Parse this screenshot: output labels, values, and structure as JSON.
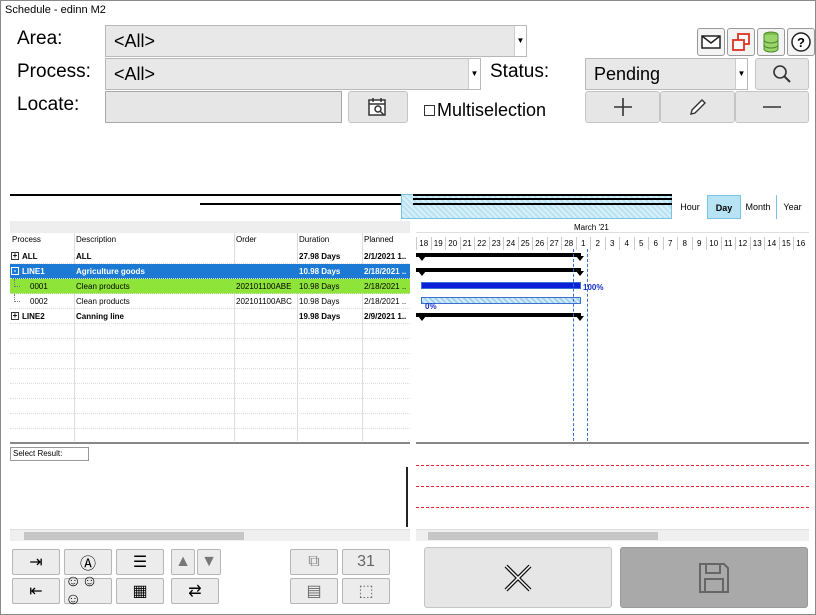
{
  "window": {
    "title": "Schedule - edinn M2"
  },
  "filters": {
    "area_label": "Area:",
    "area_value": "<All>",
    "process_label": "Process:",
    "process_value": "<All>",
    "locate_label": "Locate:",
    "locate_value": "",
    "status_label": "Status:",
    "status_value": "Pending",
    "multiselection_label": "Multiselection"
  },
  "top_icons": [
    "mail-icon",
    "windows-icon",
    "database-icon",
    "help-icon"
  ],
  "zoom_tabs": [
    "Hour",
    "Day",
    "Month",
    "Year"
  ],
  "zoom_active": "Day",
  "grid": {
    "columns": [
      "Process",
      "Description",
      "Order",
      "Duration",
      "Planned"
    ],
    "rows": [
      {
        "process": "ALL",
        "description": "ALL",
        "order": "",
        "duration": "27.98 Days",
        "planned": "2/1/2021 1..",
        "level": 0,
        "expander": "+",
        "bold": true,
        "style": "normal"
      },
      {
        "process": "LINE1",
        "description": "Agriculture goods",
        "order": "",
        "duration": "10.98 Days",
        "planned": "2/18/2021 ..",
        "level": 0,
        "expander": "-",
        "bold": true,
        "style": "selected"
      },
      {
        "process": "0001",
        "description": "Clean products",
        "order": "202101100ABE",
        "duration": "10.98 Days",
        "planned": "2/18/2021 ..",
        "level": 1,
        "expander": "",
        "bold": false,
        "style": "green"
      },
      {
        "process": "0002",
        "description": "Clean products",
        "order": "202101100ABC",
        "duration": "10.98 Days",
        "planned": "2/18/2021 ..",
        "level": 1,
        "expander": "",
        "bold": false,
        "style": "normal"
      },
      {
        "process": "LINE2",
        "description": "Canning line",
        "order": "",
        "duration": "19.98 Days",
        "planned": "2/9/2021 1..",
        "level": 0,
        "expander": "+",
        "bold": true,
        "style": "normal"
      }
    ],
    "select_result_label": "Select Result:"
  },
  "gantt": {
    "month_label": "March '21",
    "days": [
      "18",
      "19",
      "20",
      "21",
      "22",
      "23",
      "24",
      "25",
      "26",
      "27",
      "28",
      "1",
      "2",
      "3",
      "4",
      "5",
      "6",
      "7",
      "8",
      "9",
      "10",
      "11",
      "12",
      "13",
      "14",
      "15",
      "16"
    ],
    "progress_labels": [
      "100%",
      "0%"
    ],
    "progress_values": [
      1.0,
      0.0
    ]
  },
  "actions": {
    "cancel": "close-icon",
    "save": "save-icon"
  }
}
